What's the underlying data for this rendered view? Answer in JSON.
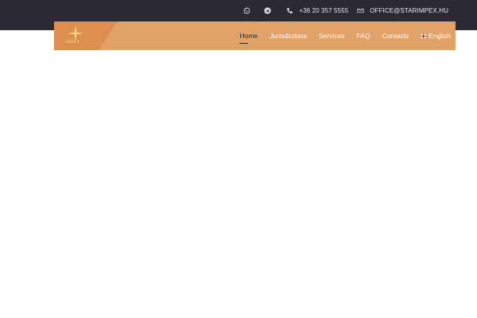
{
  "topbar": {
    "whatsapp_icon": "whatsapp-icon",
    "telegram_icon": "telegram-icon",
    "phone_icon": "phone-icon",
    "phone": "+36 20 357 5555",
    "email_icon": "email-icon",
    "email": "OFFICE@STARIMPEX.HU",
    "background": "#2b2a34"
  },
  "navbar": {
    "logo_icon": "star-logo-icon",
    "logo_text": "IMPEX",
    "items": [
      {
        "label": "Home",
        "active": true
      },
      {
        "label": "Jurisdictions"
      },
      {
        "label": "Services"
      },
      {
        "label": "FAQ"
      },
      {
        "label": "Contacts"
      }
    ],
    "language": {
      "flag_icon": "uk-flag-icon",
      "label": "English"
    },
    "accent": "#e2a167",
    "accent_dark": "#dd8f4f"
  }
}
